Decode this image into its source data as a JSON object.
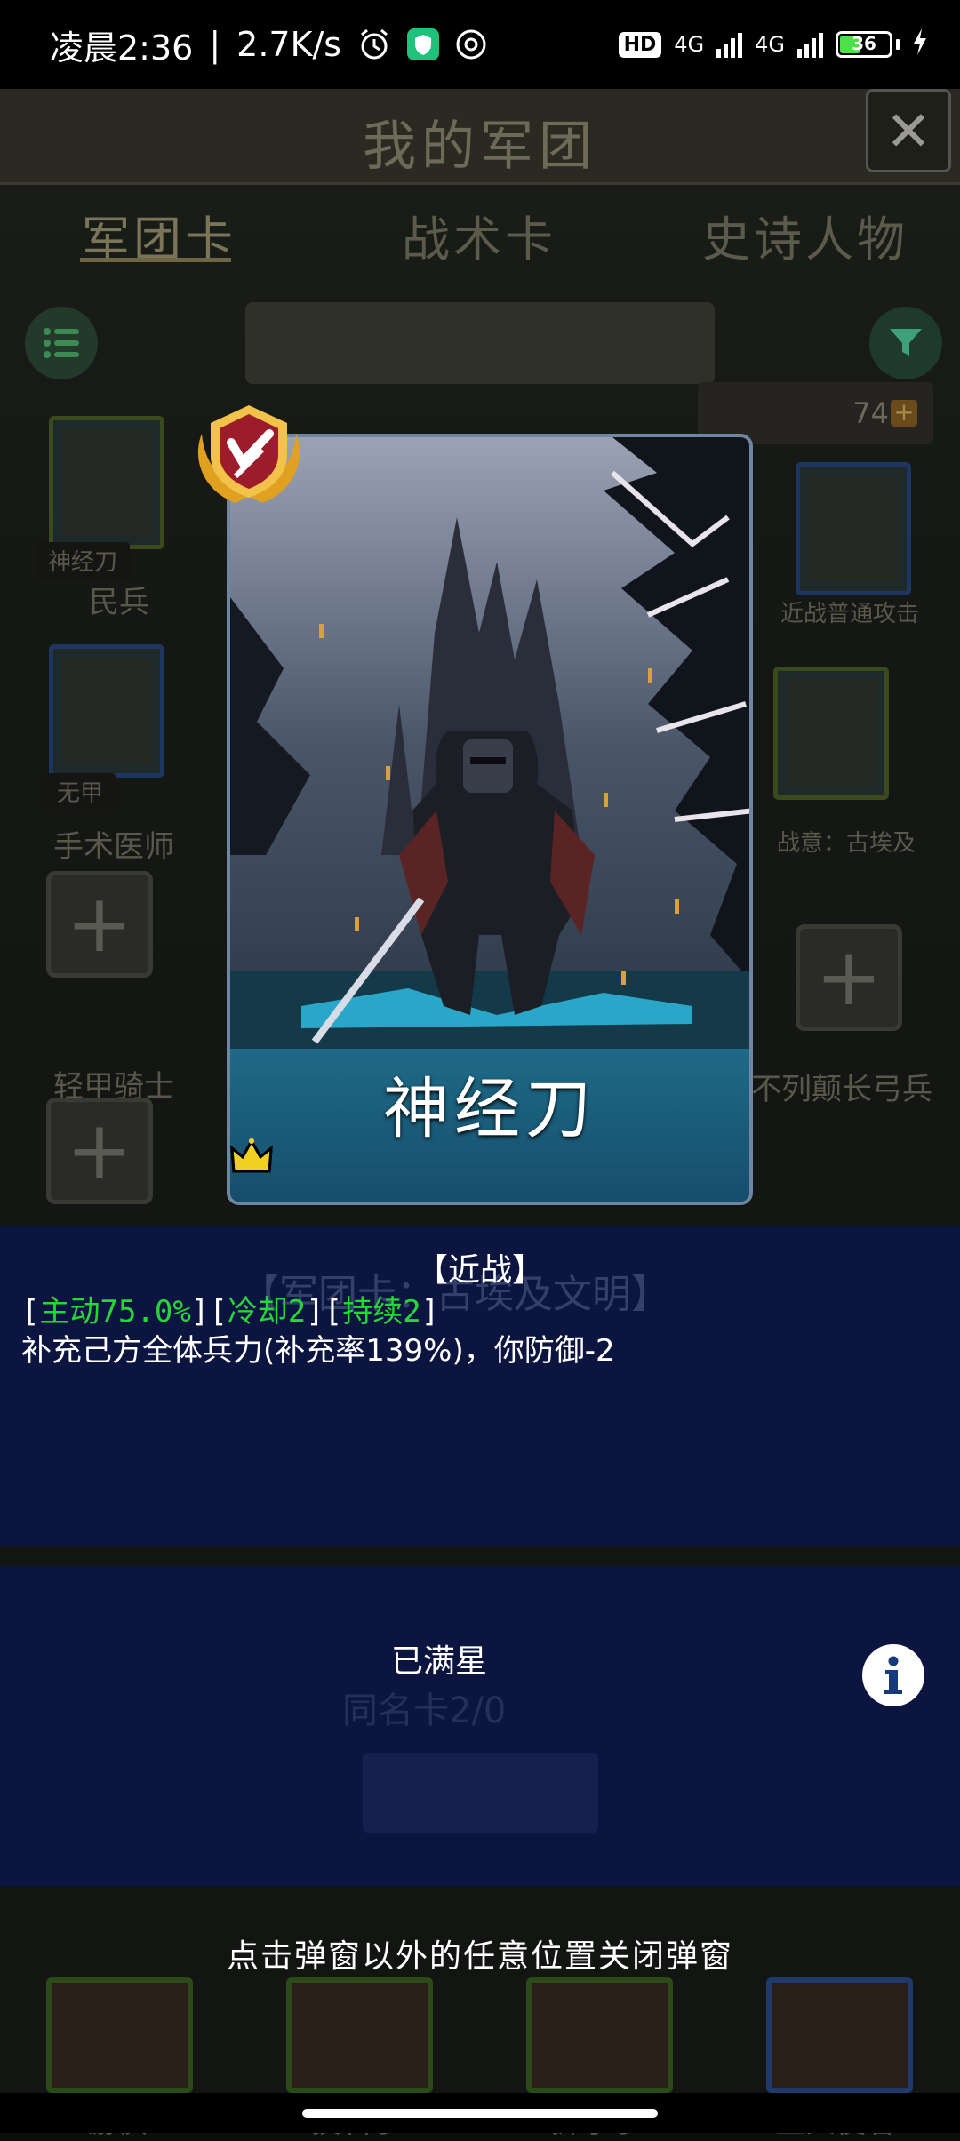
{
  "status_bar": {
    "time": "凌晨2:36",
    "net_speed": "2.7K/s",
    "hd_label": "HD",
    "net1": "4G",
    "net2": "4G",
    "battery": "36"
  },
  "screen": {
    "title": "我的军团",
    "tabs": [
      "军团卡",
      "战术卡",
      "史诗人物"
    ],
    "active_tab": "军团卡",
    "card_count": "74",
    "left_cards": [
      {
        "sub": "神经刀",
        "name": "民兵"
      },
      {
        "sub": "无甲",
        "name": "手术医师"
      },
      {
        "sub": "",
        "name": "轻甲骑士"
      }
    ],
    "right_cards": [
      {
        "name": "近战普通攻击"
      },
      {
        "name": "战意：古埃及"
      },
      {
        "name": "不列颠长弓兵"
      }
    ],
    "bottom_cards": [
      "游侠",
      "投石手",
      "掷矛手",
      "圣火使者"
    ]
  },
  "card": {
    "name": "神经刀",
    "stars": 5
  },
  "detail": {
    "type_label": "【近战】",
    "tag_open": "[",
    "tag_mid": "][",
    "tag_close": "]",
    "active": "主动75.0%",
    "cooldown": "冷却2",
    "duration": "持续2",
    "effect": "补充己方全体兵力(补充率139%)，你防御-2",
    "faint_header": "【军团卡：古埃及文明】"
  },
  "star_panel": {
    "status": "已满星",
    "faint_copy": "同名卡2/0"
  },
  "hint": "点击弹窗以外的任意位置关闭弹窗",
  "colors": {
    "accent_green": "#27d63a",
    "panel_bg": "#0c1644",
    "crown": "#f0d020"
  }
}
